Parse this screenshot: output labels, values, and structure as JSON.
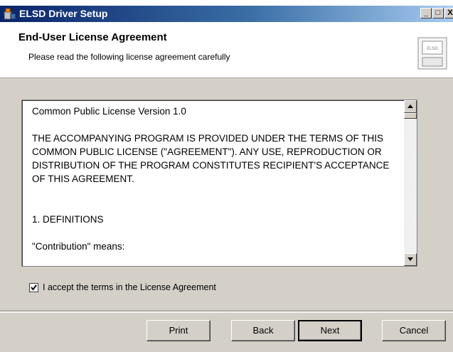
{
  "window": {
    "title": "ELSD Driver Setup",
    "controls": [
      "_",
      "□",
      "X"
    ]
  },
  "header": {
    "title": "End-User License Agreement",
    "subtitle": "Please read the following license agreement carefully",
    "logo_text": "ELSD"
  },
  "license": {
    "text": "Common Public License Version 1.0\n\nTHE ACCOMPANYING PROGRAM IS PROVIDED UNDER THE TERMS OF THIS COMMON PUBLIC LICENSE (\"AGREEMENT\"). ANY USE, REPRODUCTION OR DISTRIBUTION OF THE PROGRAM CONSTITUTES RECIPIENT'S ACCEPTANCE OF THIS AGREEMENT.\n\n\n1. DEFINITIONS\n\n\"Contribution\" means:"
  },
  "accept": {
    "label": "I accept the terms in the License Agreement",
    "checked": true
  },
  "buttons": {
    "print": "Print",
    "back": "Back",
    "next": "Next",
    "cancel": "Cancel"
  }
}
